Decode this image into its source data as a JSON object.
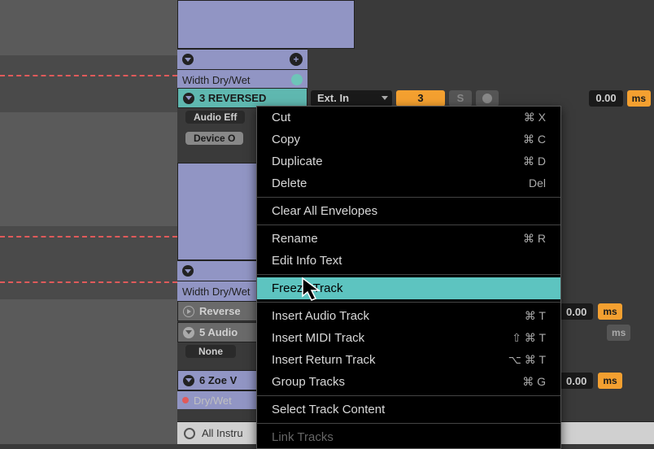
{
  "clip_top": {
    "param_label": "Width Dry/Wet"
  },
  "track3": {
    "name": "3 REVERSED",
    "effects_label": "Audio Eff",
    "device_label": "Device O",
    "dry_wet_label": "Width Dry/Wet"
  },
  "io": {
    "input_type": "Ext. In",
    "channel": "3",
    "solo": "S",
    "delay_ms": "0.00",
    "ms_label": "ms"
  },
  "track4": {
    "name": "Reverse"
  },
  "track5": {
    "name": "5 Audio",
    "none_label": "None"
  },
  "track6": {
    "name": "6 Zoe V",
    "dry_wet": "Dry/Wet"
  },
  "device_browser": {
    "label": "All Instru"
  },
  "aux_values": {
    "v1": "0.00",
    "v2": "0.00"
  },
  "ms_labels": {
    "m1": "ms",
    "m2": "ms",
    "m3": "ms"
  },
  "ctx_menu": {
    "items": [
      {
        "label": "Cut",
        "shortcut": "⌘ X"
      },
      {
        "label": "Copy",
        "shortcut": "⌘ C"
      },
      {
        "label": "Duplicate",
        "shortcut": "⌘ D"
      },
      {
        "label": "Delete",
        "shortcut": "Del"
      }
    ],
    "clear_env": "Clear All Envelopes",
    "rename": {
      "label": "Rename",
      "shortcut": "⌘ R"
    },
    "edit_info": "Edit Info Text",
    "freeze": "Freeze Track",
    "insert_audio": {
      "label": "Insert Audio Track",
      "shortcut": "⌘ T"
    },
    "insert_midi": {
      "label": "Insert MIDI Track",
      "shortcut": "⇧ ⌘ T"
    },
    "insert_return": {
      "label": "Insert Return Track",
      "shortcut": "⌥ ⌘ T"
    },
    "group": {
      "label": "Group Tracks",
      "shortcut": "⌘ G"
    },
    "select_content": "Select Track Content",
    "link": "Link Tracks"
  }
}
